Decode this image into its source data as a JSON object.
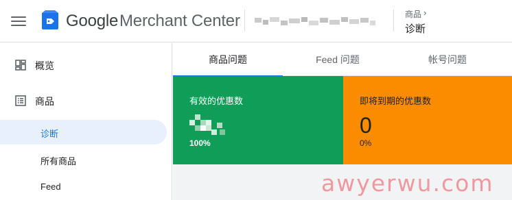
{
  "header": {
    "menu_icon": "menu-icon",
    "logo_icon": "merchant-center-tag-icon",
    "brand_google": "Google",
    "brand_rest": "Merchant Center",
    "breadcrumb_parent": "商品",
    "breadcrumb_current": "诊断"
  },
  "sidebar": {
    "items": [
      {
        "label": "概览",
        "icon": "dashboard-icon"
      },
      {
        "label": "商品",
        "icon": "list-icon"
      }
    ],
    "subitems": [
      {
        "label": "诊断",
        "active": true
      },
      {
        "label": "所有商品",
        "active": false
      },
      {
        "label": "Feed",
        "active": false
      }
    ]
  },
  "tabs": [
    {
      "label": "商品问题",
      "active": true
    },
    {
      "label": "Feed 问题",
      "active": false
    },
    {
      "label": "帐号问题",
      "active": false
    }
  ],
  "cards": {
    "valid": {
      "title": "有效的优惠数",
      "percent": "100%",
      "color": "#0f9d58"
    },
    "expiring": {
      "title": "即将到期的优惠数",
      "value": "0",
      "percent": "0%",
      "color": "#fb8c00"
    }
  },
  "watermark": "awyerwu.com",
  "colors": {
    "accent": "#1a73e8",
    "active_bg": "#e8f0fe"
  }
}
